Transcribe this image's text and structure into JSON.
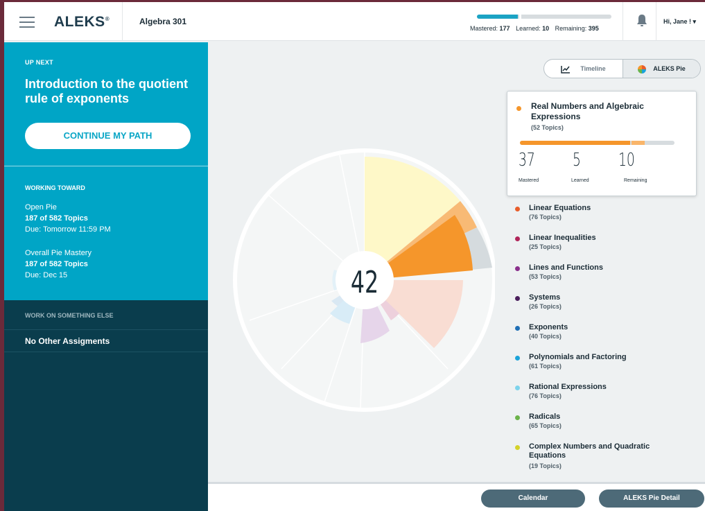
{
  "header": {
    "logo": "ALEKS",
    "course": "Algebra 301",
    "progress": {
      "mastered": 177,
      "learned": 10,
      "remaining": 395
    },
    "stats_labels": {
      "mastered": "Mastered:",
      "learned": "Learned:",
      "remaining": "Remaining:"
    },
    "stats_values": {
      "mastered": "177",
      "learned": "10",
      "remaining": "395"
    },
    "user_menu": "Hi, Jane ! ▾"
  },
  "sidebar": {
    "up_next_label": "UP NEXT",
    "up_next_title": "Introduction to the quotient rule of exponents",
    "continue_button": "CONTINUE MY PATH",
    "working_toward_label": "WORKING TOWARD",
    "goals": [
      {
        "name": "Open Pie",
        "topics": "187 of 582 Topics",
        "due": "Due: Tomorrow 11:59 PM"
      },
      {
        "name": "Overall Pie Mastery",
        "topics": "187 of 582 Topics",
        "due": "Due: Dec 15"
      }
    ],
    "work_else_label": "WORK ON SOMETHING ELSE",
    "no_other": "No Other Assigments"
  },
  "main": {
    "toggle": {
      "timeline": "Timeline",
      "pie": "ALEKS Pie"
    },
    "pie_center": "42",
    "detail": {
      "name": "Real Numbers and Algebraic Expressions",
      "topics": "(52 Topics)",
      "mastered": "37",
      "learned": "5",
      "remaining": "10",
      "mastered_label": "Mastered",
      "learned_label": "Learned",
      "remaining_label": "Remaining",
      "color": "#f5962b"
    },
    "legend": [
      {
        "name": "Linear Equations",
        "topics": "(76 Topics)",
        "color": "#e85d2a"
      },
      {
        "name": "Linear Inequalities",
        "topics": "(25 Topics)",
        "color": "#b0255a"
      },
      {
        "name": "Lines and Functions",
        "topics": "(53 Topics)",
        "color": "#8a2f8c"
      },
      {
        "name": "Systems",
        "topics": "(26 Topics)",
        "color": "#4a1f5c"
      },
      {
        "name": "Exponents",
        "topics": "(40 Topics)",
        "color": "#1f6fb5"
      },
      {
        "name": "Polynomials and Factoring",
        "topics": "(61 Topics)",
        "color": "#1ba3d9"
      },
      {
        "name": "Rational Expressions",
        "topics": "(76 Topics)",
        "color": "#7dd3ec"
      },
      {
        "name": "Radicals",
        "topics": "(65 Topics)",
        "color": "#6bb34a"
      },
      {
        "name": "Complex Numbers and Quadratic Equations",
        "topics": "(19 Topics)",
        "color": "#d4d22a"
      }
    ]
  },
  "footer": {
    "calendar": "Calendar",
    "pie_detail": "ALEKS Pie Detail"
  }
}
